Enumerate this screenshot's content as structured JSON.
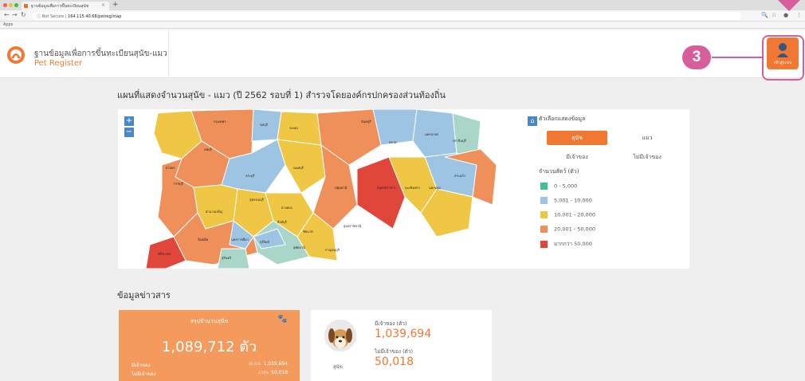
{
  "browser": {
    "tab_title": "ฐานข้อมูลเพื่อการขึ้นทะเบียนสุนัข",
    "url_prefix": "Not Secure",
    "url": "164.115.40.68/petreg/map",
    "bookmarks_label": "Apps"
  },
  "header": {
    "title_th": "ฐานข้อมูลเพื่อการขึ้นทะเบียนสุนัข-แมว",
    "title_en": "Pet Register",
    "user_label": "เข้าสู่ระบบ",
    "callout_number": "3"
  },
  "map_section": {
    "title": "แผนที่แสดงจำนวนสุนัข - แมว (ปี 2562 รอบที่ 1) สำรวจโดยองค์กรปกครองส่วนท้องถิ่น",
    "zoom_in": "+",
    "zoom_out": "−",
    "home": "⌂",
    "panel_title": "ตัวเลือกแสดงข้อมูล",
    "options": [
      {
        "label": "สุนัข",
        "active": true
      },
      {
        "label": "แมว",
        "active": false
      },
      {
        "label": "มีเจ้าของ",
        "active": false
      },
      {
        "label": "ไม่มีเจ้าของ",
        "active": false
      }
    ],
    "legend_title": "จำนวนสัตว์ (ตัว)",
    "legend": [
      {
        "label": "0 - 5,000",
        "color": "#3fbf9b"
      },
      {
        "label": "5,001 - 10,000",
        "color": "#9ec4e4"
      },
      {
        "label": "10,001 - 20,000",
        "color": "#efc744"
      },
      {
        "label": "20,001 - 50,000",
        "color": "#ef8f5a"
      },
      {
        "label": "มากกว่า 50,000",
        "color": "#e0463a"
      }
    ],
    "region_labels": [
      "กรุงเทพฯ",
      "ชลบุรี",
      "ระยอง",
      "จันทบุรี",
      "ตราด",
      "นครนายก",
      "ปราจีนบุรี",
      "สระแก้ว",
      "ลพบุรี",
      "สระบุรี",
      "นนทบุรี",
      "ปทุมธานี",
      "สมุทรปราการ",
      "ฉะเชิงเทรา",
      "นครปฐม",
      "ราชบุรี",
      "สุพรรณบุรี",
      "อ่างทอง",
      "สิงห์บุรี",
      "ชัยนาท",
      "อุทัยธานี",
      "กาญจนบุรี",
      "นครราชสีมา",
      "บุรีรัมย์",
      "สุรินทร์",
      "ศรีสะเกษ",
      "อุบลราชธานี",
      "ยโสธร",
      "อำนาจเจริญ",
      "ร้อยเอ็ด"
    ]
  },
  "news_section": {
    "title": "ข้อมูลข่าวสาร",
    "summary": {
      "label": "สรุปจำนวนสุนัข",
      "total": "1,089,712 ตัว",
      "owned_label": "มีเจ้าของ",
      "owned_pct": "95.41%",
      "owned_value": "1,039,694",
      "stray_label": "ไม่มีเจ้าของ",
      "stray_pct": "4.59%",
      "stray_value": "50,018"
    },
    "dog": {
      "name": "สุนัข",
      "owned_label": "มีเจ้าของ (ตัว)",
      "owned_value": "1,039,694",
      "stray_label": "ไม่มีเจ้าของ (ตัว)",
      "stray_value": "50,018"
    }
  }
}
